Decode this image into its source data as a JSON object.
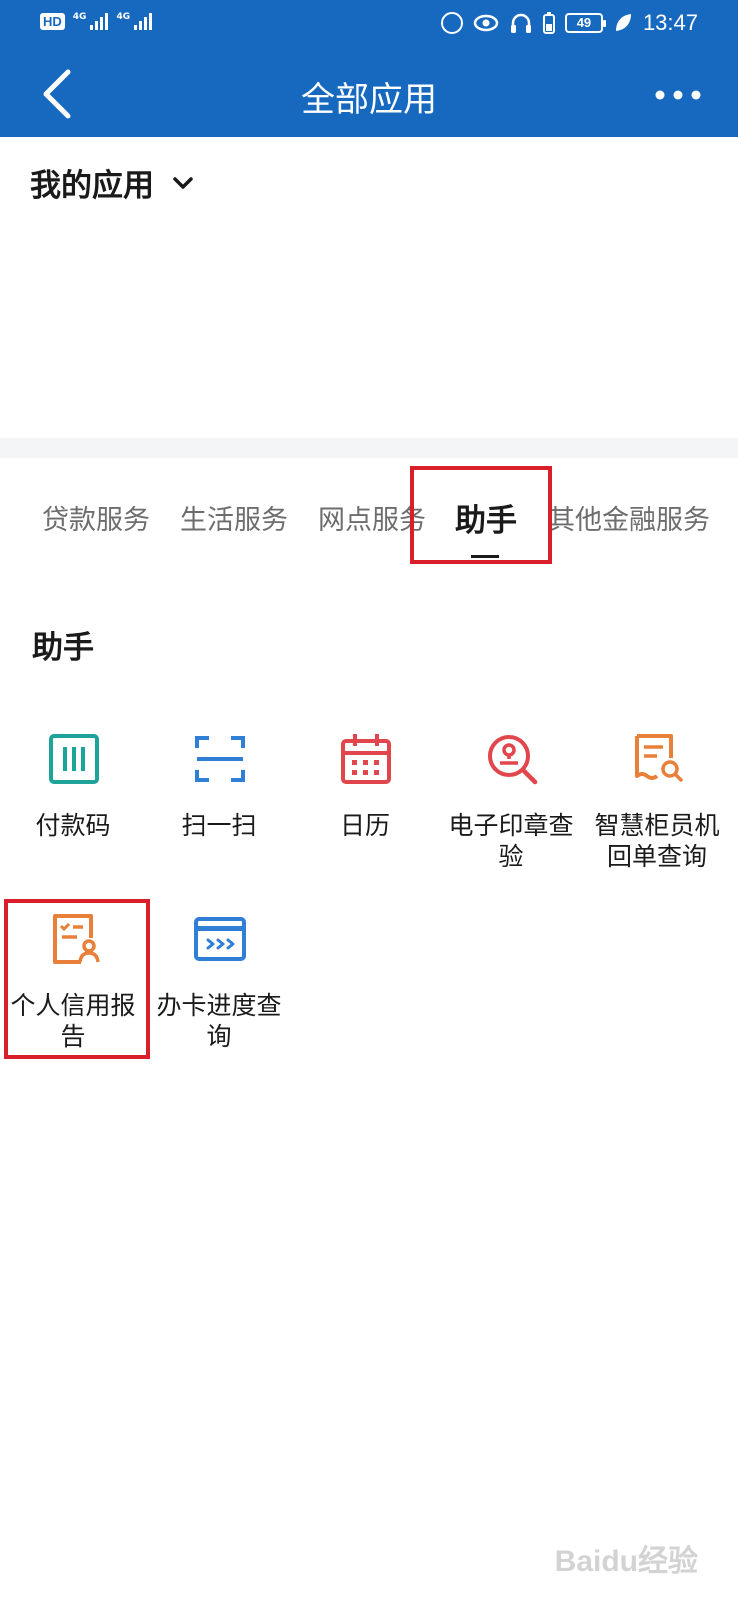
{
  "status_bar": {
    "hd_label": "HD",
    "signal_1_tag": "4G",
    "signal_2_tag": "4G",
    "battery_level": "49",
    "time": "13:47"
  },
  "navbar": {
    "title": "全部应用",
    "back_icon": "chevron-left-icon",
    "more_icon": "more-horizontal-icon"
  },
  "my_apps": {
    "title": "我的应用",
    "toggle_icon": "chevron-down-icon"
  },
  "tabs": [
    {
      "label": "贷款服务"
    },
    {
      "label": "生活服务"
    },
    {
      "label": "网点服务"
    },
    {
      "label": "助手",
      "active": true
    },
    {
      "label": "其他金融服务"
    }
  ],
  "section": {
    "title": "助手",
    "apps": [
      {
        "label": "付款码",
        "icon": "payment-code-icon",
        "color": "#1ea39a"
      },
      {
        "label": "扫一扫",
        "icon": "scan-icon",
        "color": "#2f7fd6"
      },
      {
        "label": "日历",
        "icon": "calendar-icon",
        "color": "#e0464b"
      },
      {
        "label": "电子印章查验",
        "icon": "seal-search-icon",
        "color": "#e0464b"
      },
      {
        "label": "智慧柜员机回单查询",
        "icon": "receipt-search-icon",
        "color": "#e8803a"
      },
      {
        "label": "个人信用报告",
        "icon": "credit-report-icon",
        "color": "#e8803a"
      },
      {
        "label": "办卡进度查询",
        "icon": "card-progress-icon",
        "color": "#2f7fd6"
      }
    ]
  },
  "colors": {
    "header_bg": "#1769c0",
    "highlight": "#d9202a",
    "divider": "#f4f5f7"
  },
  "watermark": "Baidu经验"
}
